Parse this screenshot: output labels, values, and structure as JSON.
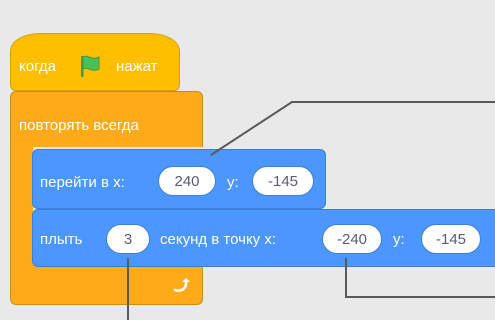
{
  "blocks": {
    "when_flag": {
      "prefix": "когда",
      "suffix": "нажат",
      "flag_icon": "green-flag-icon"
    },
    "forever": {
      "label": "повторять всегда",
      "loop_icon": "loop-arrow-icon"
    },
    "goto": {
      "label": "перейти в x:",
      "x": "240",
      "y_label": "y:",
      "y": "-145"
    },
    "glide": {
      "label": "плыть",
      "secs": "3",
      "mid": "секунд в точку x:",
      "x": "-240",
      "y_label": "y:",
      "y": "-145"
    }
  },
  "colors": {
    "events": "#ffbf00",
    "control": "#ffab19",
    "motion": "#4c97ff",
    "flag": "#4cbf56"
  }
}
